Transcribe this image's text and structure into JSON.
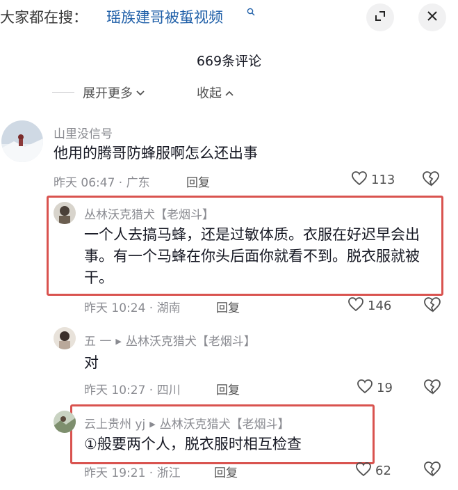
{
  "header": {
    "search_prefix": "大家都在搜：",
    "search_query": "瑶族建哥被蜇视频",
    "search_icon": "search-icon",
    "expand_icon": "expand-icon",
    "close_icon": "close-icon"
  },
  "comments_count_title": "669条评论",
  "fold_controls": {
    "expand_more": "展开更多",
    "collapse": "收起"
  },
  "comments": [
    {
      "username": "山里没信号",
      "text": "他用的腾哥防蜂服啊怎么还出事",
      "time_location": "昨天 06:47 · 广东",
      "reply_label": "回复",
      "likes": "113"
    }
  ],
  "replies": [
    {
      "username": "丛林沃克猎犬【老烟斗】",
      "text": "一个人去搞马蜂，还是过敏体质。衣服在好迟早会出事。有一个马蜂在你头后面你就看不到。脱衣服就被干。",
      "time_location": "昨天 10:24 · 湖南",
      "reply_label": "回复",
      "likes": "146"
    },
    {
      "username": "五 一",
      "reply_to": "丛林沃克猎犬【老烟斗】",
      "text": "对",
      "time_location": "昨天 10:27 · 四川",
      "reply_label": "回复",
      "likes": "19"
    },
    {
      "username": "云上贵州 yj",
      "reply_to": "丛林沃克猎犬【老烟斗】",
      "text": "①般要两个人，脱衣服时相互检查",
      "time_location": "昨天 19:21 · 浙江",
      "reply_label": "回复",
      "likes": "62"
    }
  ],
  "colors": {
    "highlight_border": "#d9534f",
    "link_blue": "#1f5fa8",
    "secondary_text": "#8a8b91"
  }
}
